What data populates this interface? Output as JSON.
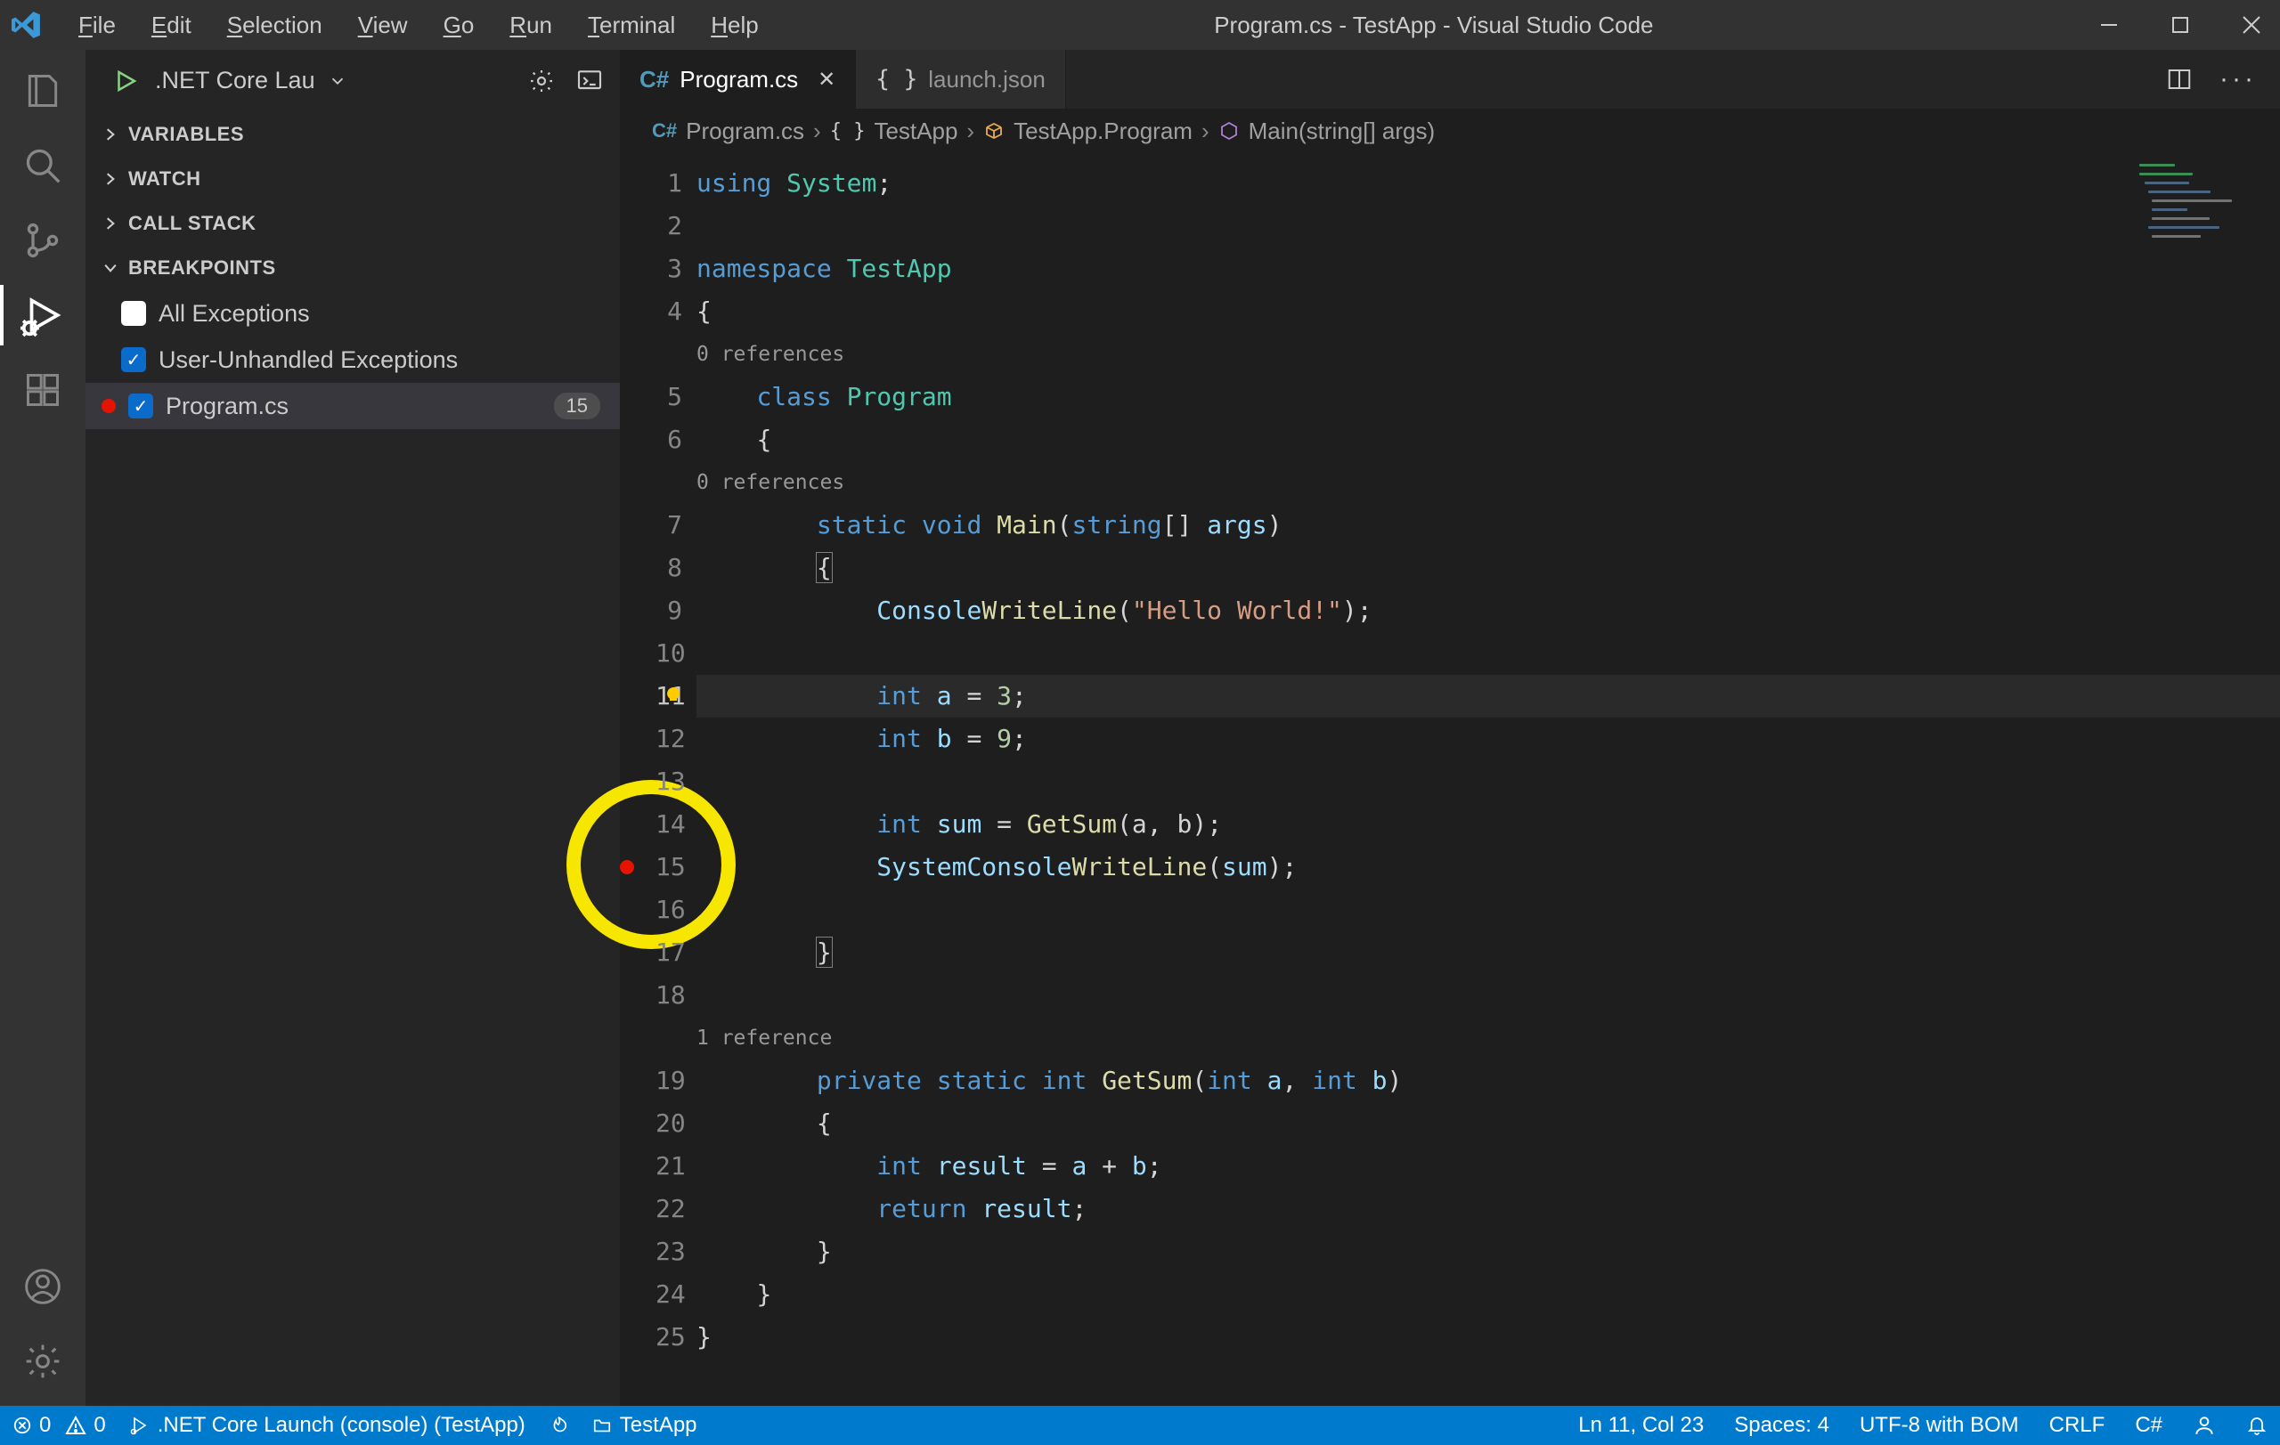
{
  "title": "Program.cs - TestApp - Visual Studio Code",
  "menu": [
    "File",
    "Edit",
    "Selection",
    "View",
    "Go",
    "Run",
    "Terminal",
    "Help"
  ],
  "activity": {
    "active": 3
  },
  "debug_top": {
    "config_label": ".NET Core Lau"
  },
  "sidebar": {
    "sections": {
      "variables": "VARIABLES",
      "watch": "WATCH",
      "callstack": "CALL STACK",
      "breakpoints": "BREAKPOINTS"
    },
    "breakpoints": {
      "all_exceptions": {
        "label": "All Exceptions",
        "checked": false
      },
      "user_unhandled": {
        "label": "User-Unhandled Exceptions",
        "checked": true
      },
      "file": {
        "label": "Program.cs",
        "checked": true,
        "line_badge": "15"
      }
    }
  },
  "tabs": {
    "active": {
      "icon": "C#",
      "label": "Program.cs"
    },
    "other": {
      "label": "launch.json"
    }
  },
  "breadcrumb": {
    "a": "Program.cs",
    "b": "TestApp",
    "c": "TestApp.Program",
    "d": "Main(string[] args)"
  },
  "codelens": {
    "zero": "0 references",
    "one": "1 reference"
  },
  "code": {
    "l1": {
      "using": "using",
      "system": "System",
      ";": ";"
    },
    "l3": {
      "namespace": "namespace",
      "name": "TestApp"
    },
    "l5": {
      "class": "class",
      "name": "Program"
    },
    "l7": {
      "static": "static",
      "void": "void",
      "main": "Main",
      "sig": "(",
      "string": "string",
      "arr": "[]",
      "args": "args",
      ")": ")"
    },
    "l9": {
      "console": "Console",
      ".": ".",
      "write": "WriteLine",
      "open": "(",
      "str": "\"Hello World!\"",
      "close": ");"
    },
    "l11": {
      "int": "int",
      "a": "a",
      "eq": "=",
      "v": "3",
      ";": ";"
    },
    "l12": {
      "int": "int",
      "b": "b",
      "eq": "=",
      "v": "9",
      ";": ";"
    },
    "l14": {
      "int": "int",
      "sum": "sum",
      "eq": "=",
      "fn": "GetSum",
      "args": "(a, b);"
    },
    "l15": {
      "sys": "System",
      ".": ".",
      "con": "Console",
      ".2": ".",
      "wr": "WriteLine",
      "open": "(",
      "sum": "sum",
      ");": ");"
    },
    "l19": {
      "private": "private",
      "static": "static",
      "int": "int",
      "fn": "GetSum",
      "open": "(",
      "int1": "int",
      "a": "a",
      ",": ", ",
      "int2": "int",
      "b": "b",
      ")": ")"
    },
    "l21": {
      "int": "int",
      "result": "result",
      "eq": "=",
      "a": "a",
      "plus": " + ",
      "b": "b",
      ";": ";"
    },
    "l22": {
      "return": "return",
      "result": "result",
      ";": ";"
    }
  },
  "gutter_lines": [
    "1",
    "2",
    "3",
    "4",
    "5",
    "6",
    "7",
    "8",
    "9",
    "10",
    "11",
    "12",
    "13",
    "14",
    "15",
    "16",
    "17",
    "18",
    "19",
    "20",
    "21",
    "22",
    "23",
    "24",
    "25"
  ],
  "breakpoint_line": 15,
  "status": {
    "errors": "0",
    "warnings": "0",
    "debug_config": ".NET Core Launch (console) (TestApp)",
    "folder": "TestApp",
    "ln_col": "Ln 11, Col 23",
    "spaces": "Spaces: 4",
    "encoding": "UTF-8 with BOM",
    "eol": "CRLF",
    "lang": "C#"
  }
}
